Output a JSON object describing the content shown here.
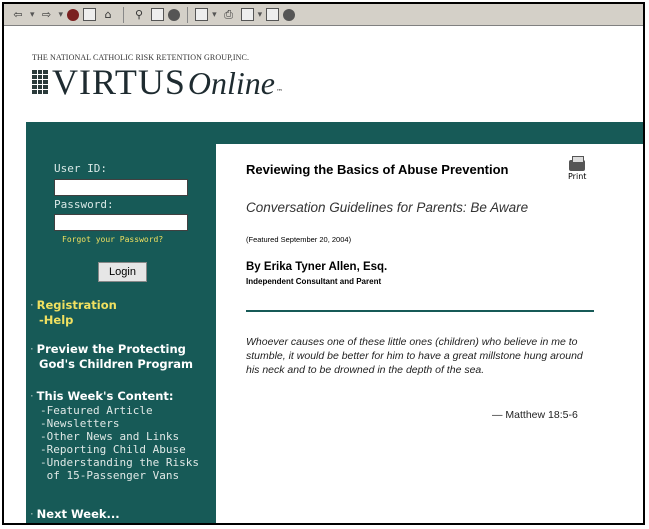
{
  "header": {
    "org_name": "THE NATIONAL CATHOLIC RISK RETENTION GROUP,INC.",
    "logo_main": "VIRTUS",
    "logo_script": "Online",
    "logo_tm": "™"
  },
  "login": {
    "user_id_label": "User ID:",
    "password_label": "Password:",
    "forgot_label": "Forgot your Password?",
    "login_button": "Login",
    "user_id_value": "",
    "password_value": ""
  },
  "nav": {
    "registration": "Registration",
    "help": "-Help",
    "preview_line1": "Preview the Protecting",
    "preview_line2": "God's Children Program",
    "this_week": "This Week's Content:",
    "this_week_items": [
      "-Featured Article",
      "-Newsletters",
      "-Other News and Links",
      "-Reporting Child Abuse",
      "-Understanding the Risks",
      " of 15-Passenger Vans"
    ],
    "next_week": "Next Week..."
  },
  "article": {
    "title": "Reviewing the Basics of Abuse Prevention",
    "print_label": "Print",
    "subtitle": "Conversation Guidelines for Parents: Be Aware",
    "featured": "(Featured September 20, 2004)",
    "author": "By Erika Tyner Allen, Esq.",
    "author_role": "Independent Consultant and Parent",
    "quote": "Whoever causes one of these little ones (children) who believe in me to stumble, it would be better for him to have a great millstone hung around his neck and to be drowned in the depth of the sea.",
    "citation": "— Matthew 18:5-6"
  },
  "colors": {
    "teal": "#175a57",
    "nav_yellow": "#f0e060"
  }
}
